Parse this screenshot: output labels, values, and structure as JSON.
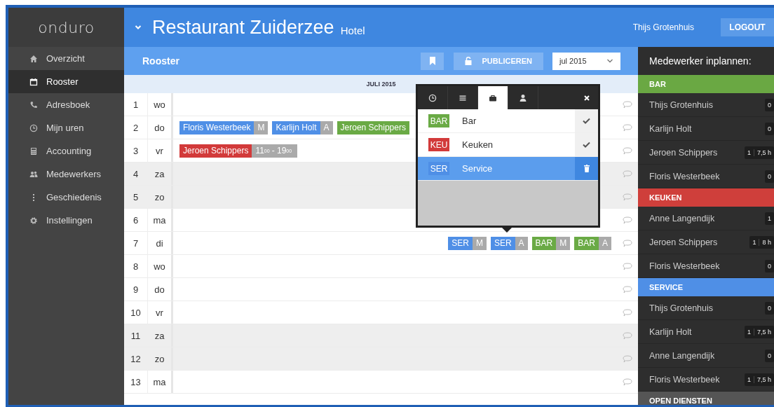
{
  "sidebar": {
    "logo": "onduro",
    "items": [
      {
        "label": "Overzicht",
        "selected": false
      },
      {
        "label": "Rooster",
        "selected": true
      },
      {
        "label": "Adresboek",
        "selected": false
      },
      {
        "label": "Mijn uren",
        "selected": false
      },
      {
        "label": "Accounting",
        "selected": false
      },
      {
        "label": "Medewerkers",
        "selected": false
      },
      {
        "label": "Geschiedenis",
        "selected": false
      },
      {
        "label": "Instellingen",
        "selected": false
      }
    ]
  },
  "header": {
    "title": "Restaurant Zuiderzee",
    "subtitle": "Hotel",
    "user": "Thijs Grotenhuis",
    "logout": "LOGOUT"
  },
  "toolbar": {
    "title": "Rooster",
    "publish": "PUBLICEREN",
    "month": "jul 2015"
  },
  "calendar": {
    "month": "JULI 2015",
    "rows": [
      {
        "day": "1",
        "weekday": "wo",
        "weekend": false,
        "shifts": [],
        "open_shifts": []
      },
      {
        "day": "2",
        "weekday": "do",
        "weekend": false,
        "shifts": [
          {
            "label": "Floris Westerbeek",
            "tag": "M",
            "color": "#4f8fe6"
          },
          {
            "label": "Karlijn Holt",
            "tag": "A",
            "color": "#4f8fe6"
          },
          {
            "label": "Jeroen Schippers",
            "color": "#6aaa45"
          }
        ],
        "open_shifts": []
      },
      {
        "day": "3",
        "weekday": "vr",
        "weekend": false,
        "shifts": [
          {
            "label": "Jeroen Schippers",
            "tag": "11$^{00}$ - 19$^{00}$",
            "color": "#d23a3a"
          }
        ],
        "open_shifts": []
      },
      {
        "day": "4",
        "weekday": "za",
        "weekend": true,
        "shifts": [],
        "open_shifts": []
      },
      {
        "day": "5",
        "weekday": "zo",
        "weekend": true,
        "shifts": [],
        "open_shifts": []
      },
      {
        "day": "6",
        "weekday": "ma",
        "weekend": false,
        "shifts": [],
        "open_shifts": []
      },
      {
        "day": "7",
        "weekday": "di",
        "weekend": false,
        "shifts": [],
        "open_shifts": [
          {
            "label": "SER",
            "tag": "M",
            "color": "#4f8fe6"
          },
          {
            "label": "SER",
            "tag": "A",
            "color": "#4f8fe6"
          },
          {
            "label": "BAR",
            "tag": "M",
            "color": "#6aaa45"
          },
          {
            "label": "BAR",
            "tag": "A",
            "color": "#6aaa45"
          }
        ]
      },
      {
        "day": "8",
        "weekday": "wo",
        "weekend": false,
        "shifts": [],
        "open_shifts": []
      },
      {
        "day": "9",
        "weekday": "do",
        "weekend": false,
        "shifts": [],
        "open_shifts": []
      },
      {
        "day": "10",
        "weekday": "vr",
        "weekend": false,
        "shifts": [],
        "open_shifts": []
      },
      {
        "day": "11",
        "weekday": "za",
        "weekend": true,
        "shifts": [],
        "open_shifts": []
      },
      {
        "day": "12",
        "weekday": "zo",
        "weekend": true,
        "shifts": [],
        "open_shifts": []
      },
      {
        "day": "13",
        "weekday": "ma",
        "weekend": false,
        "shifts": [],
        "open_shifts": []
      }
    ]
  },
  "popover": {
    "tabs": [
      {
        "selected": false
      },
      {
        "selected": false
      },
      {
        "selected": true
      },
      {
        "selected": false
      }
    ],
    "items": [
      {
        "code": "BAR",
        "name": "Bar",
        "color": "#6aaa45",
        "selected": false
      },
      {
        "code": "KEU",
        "name": "Keuken",
        "color": "#d23a3a",
        "selected": false
      },
      {
        "code": "SER",
        "name": "Service",
        "color": "#4f8fe6",
        "selected": true
      }
    ]
  },
  "planner": {
    "title": "Medewerker inplannen:",
    "groups": [
      {
        "name": "BAR",
        "color": "#6aa843",
        "members": [
          {
            "name": "Thijs Grotenhuis",
            "count": "0"
          },
          {
            "name": "Karlijn Holt",
            "count": "0"
          },
          {
            "name": "Jeroen Schippers",
            "count": "1",
            "hours": "7,5 h"
          },
          {
            "name": "Floris Westerbeek",
            "count": "0"
          }
        ]
      },
      {
        "name": "KEUKEN",
        "color": "#cf3f3b",
        "members": [
          {
            "name": "Anne Langendijk",
            "count": "1"
          },
          {
            "name": "Jeroen Schippers",
            "count": "1",
            "hours": "8 h"
          },
          {
            "name": "Floris Westerbeek",
            "count": "0"
          }
        ]
      },
      {
        "name": "SERVICE",
        "color": "#4f8fe6",
        "members": [
          {
            "name": "Thijs Grotenhuis",
            "count": "0"
          },
          {
            "name": "Karlijn Holt",
            "count": "1",
            "hours": "7,5 h"
          },
          {
            "name": "Anne Langendijk",
            "count": "0"
          },
          {
            "name": "Floris Westerbeek",
            "count": "1",
            "hours": "7,5 h"
          }
        ]
      },
      {
        "name": "OPEN DIENSTEN",
        "color": "#555555"
      }
    ]
  }
}
